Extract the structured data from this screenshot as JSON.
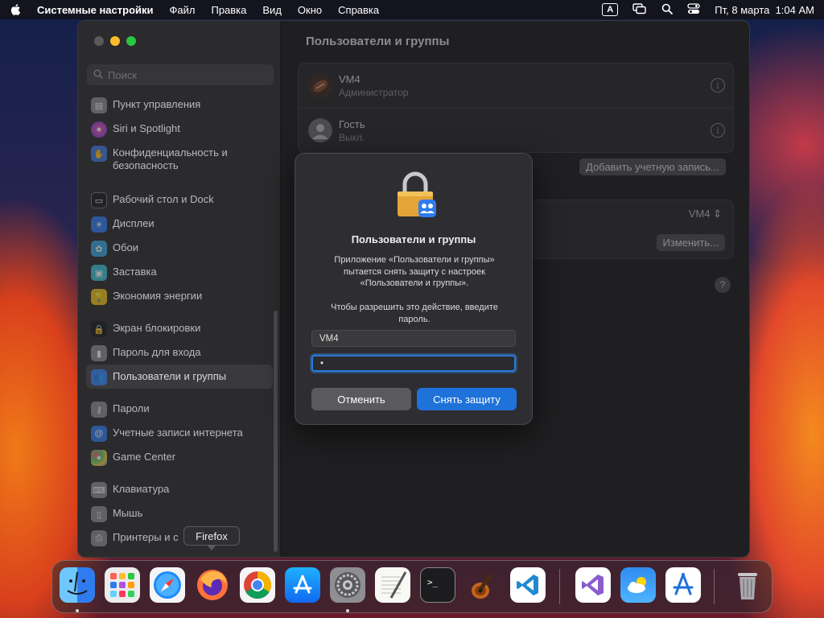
{
  "menubar": {
    "app_name": "Системные настройки",
    "items": [
      "Файл",
      "Правка",
      "Вид",
      "Окно",
      "Справка"
    ],
    "input_indicator": "A",
    "clock": "Пт, 8 марта  1:04 AM"
  },
  "sidebar": {
    "search_placeholder": "Поиск",
    "items": [
      {
        "label": "Пункт управления",
        "icon": "control-center-icon",
        "color": "#8e8e93"
      },
      {
        "label": "Siri и Spotlight",
        "icon": "siri-icon",
        "color": "#c44ad9"
      },
      {
        "label": "Конфиденциальность и безопасность",
        "icon": "hand-icon",
        "color": "#3d7be3"
      },
      {
        "label": "Рабочий стол и Dock",
        "icon": "desktop-icon",
        "color": "#1c1c1e"
      },
      {
        "label": "Дисплеи",
        "icon": "display-icon",
        "color": "#2f7cf0"
      },
      {
        "label": "Обои",
        "icon": "wallpaper-icon",
        "color": "#38a6e0"
      },
      {
        "label": "Заставка",
        "icon": "screensaver-icon",
        "color": "#3ac4d6"
      },
      {
        "label": "Экономия энергии",
        "icon": "energy-icon",
        "color": "#f0c419"
      },
      {
        "label": "Экран блокировки",
        "icon": "lock-screen-icon",
        "color": "#1c1c1e"
      },
      {
        "label": "Пароль для входа",
        "icon": "login-password-icon",
        "color": "#8e8e93"
      },
      {
        "label": "Пользователи и группы",
        "icon": "users-groups-icon",
        "color": "#2f7cf0"
      },
      {
        "label": "Пароли",
        "icon": "key-icon",
        "color": "#8e8e93"
      },
      {
        "label": "Учетные записи интернета",
        "icon": "at-icon",
        "color": "#2f7cf0"
      },
      {
        "label": "Game Center",
        "icon": "game-center-icon",
        "color": "#e6c84f"
      },
      {
        "label": "Клавиатура",
        "icon": "keyboard-icon",
        "color": "#8e8e93"
      },
      {
        "label": "Мышь",
        "icon": "mouse-icon",
        "color": "#8e8e93"
      },
      {
        "label": "Принтеры и с",
        "icon": "printer-icon",
        "color": "#8e8e93"
      }
    ]
  },
  "main": {
    "title": "Пользователи и группы",
    "users": [
      {
        "name": "VM4",
        "role": "Администратор"
      },
      {
        "name": "Гость",
        "role": "Выкл."
      }
    ],
    "add_account_button": "Добавить учетную запись...",
    "autologin_value": "VM4",
    "change_button": "Изменить...",
    "help": "?"
  },
  "dialog": {
    "title": "Пользователи и группы",
    "message": "Приложение «Пользователи и группы» пытается снять защиту с настроек «Пользователи и группы».",
    "message2": "Чтобы разрешить это действие, введите пароль.",
    "username": "VM4",
    "password_mask": "•",
    "cancel": "Отменить",
    "unlock": "Снять защиту"
  },
  "dock": {
    "tooltip": "Firefox",
    "apps": [
      "finder",
      "launchpad",
      "safari",
      "firefox",
      "chrome",
      "app-store",
      "system-settings",
      "textedit",
      "terminal",
      "garageband",
      "vscode",
      "visual-studio",
      "weather",
      "xcode-instruments",
      "trash"
    ]
  }
}
